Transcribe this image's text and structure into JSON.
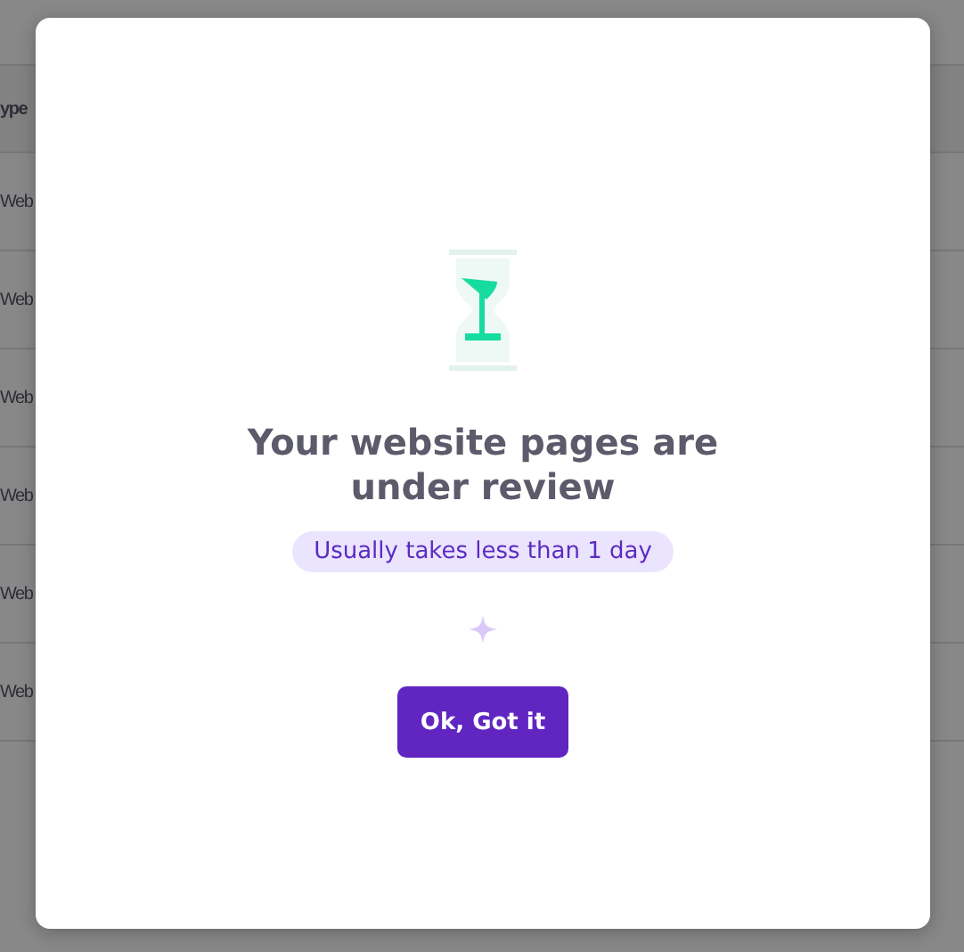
{
  "background_table": {
    "column_header": "ype",
    "rows": [
      {
        "cell": "Web"
      },
      {
        "cell": "Web"
      },
      {
        "cell": "Web"
      },
      {
        "cell": "Web"
      },
      {
        "cell": "Web"
      },
      {
        "cell": "Web"
      }
    ]
  },
  "dialog": {
    "title": "Your website pages are under review",
    "badge": "Usually takes less than 1 day",
    "button": "Ok, Got it"
  }
}
